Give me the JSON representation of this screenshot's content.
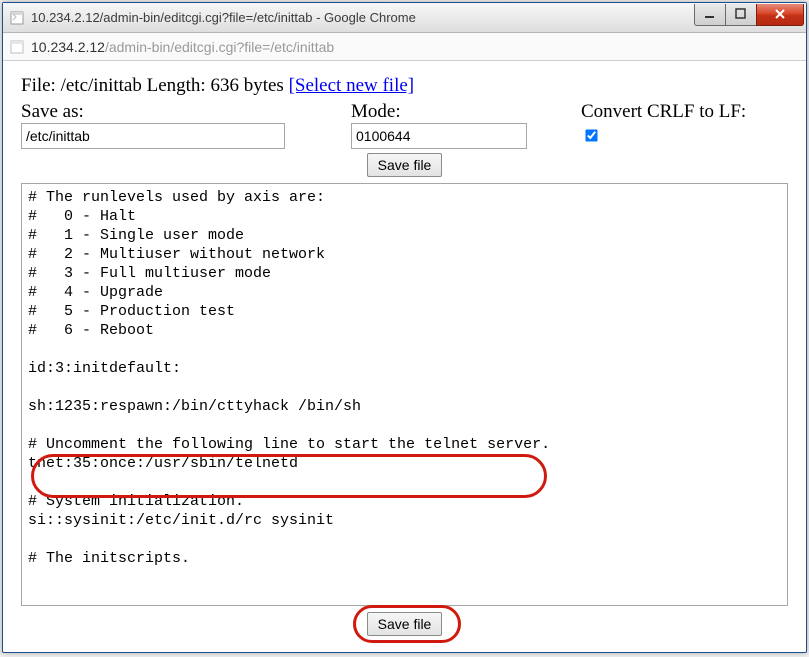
{
  "window": {
    "title": "10.234.2.12/admin-bin/editcgi.cgi?file=/etc/inittab - Google Chrome",
    "url_host": "10.234.2.12",
    "url_path": "/admin-bin/editcgi.cgi?file=/etc/inittab"
  },
  "file_header": {
    "prefix": "File: ",
    "path": "/etc/inittab",
    "length_label": " Length: ",
    "length_value": "636 bytes ",
    "select_link": "[Select new file]"
  },
  "form": {
    "save_as_label": "Save as:",
    "save_as_value": "/etc/inittab",
    "mode_label": "Mode:",
    "mode_value": "0100644",
    "crlf_label": "Convert CRLF to LF:",
    "crlf_checked": true,
    "save_button": "Save file",
    "save_button_bottom": "Save file"
  },
  "editor_text": "# The runlevels used by axis are:\n#   0 - Halt\n#   1 - Single user mode\n#   2 - Multiuser without network\n#   3 - Full multiuser mode\n#   4 - Upgrade\n#   5 - Production test\n#   6 - Reboot\n\nid:3:initdefault:\n\nsh:1235:respawn:/bin/cttyhack /bin/sh\n\n# Uncomment the following line to start the telnet server.\ntnet:35:once:/usr/sbin/telnetd\n\n# System initialization.\nsi::sysinit:/etc/init.d/rc sysinit\n\n# The initscripts."
}
